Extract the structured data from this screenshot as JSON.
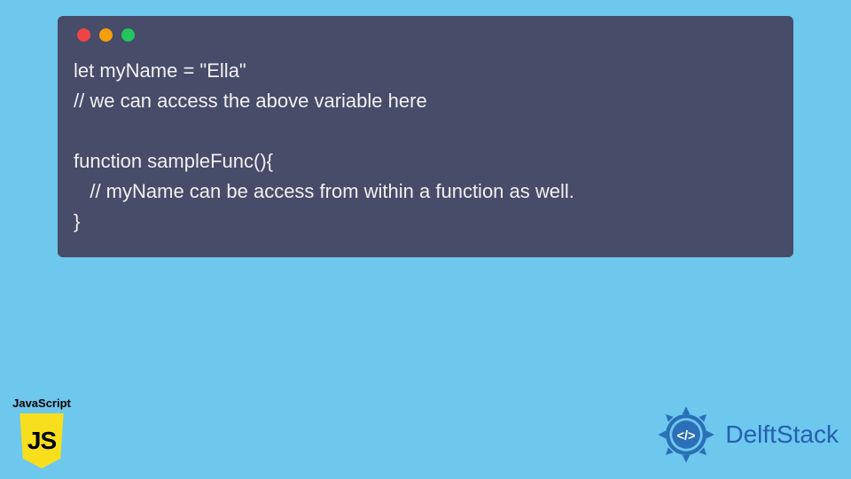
{
  "code": {
    "lines": [
      "let myName = \"Ella\"",
      "// we can access the above variable here",
      "",
      "function sampleFunc(){",
      "   // myName can be access from within a function as well.",
      "}"
    ]
  },
  "js_badge": {
    "label": "JavaScript",
    "shield_text": "JS"
  },
  "delft": {
    "brand_text": "DelftStack",
    "gear_color": "#2a6fb8"
  }
}
